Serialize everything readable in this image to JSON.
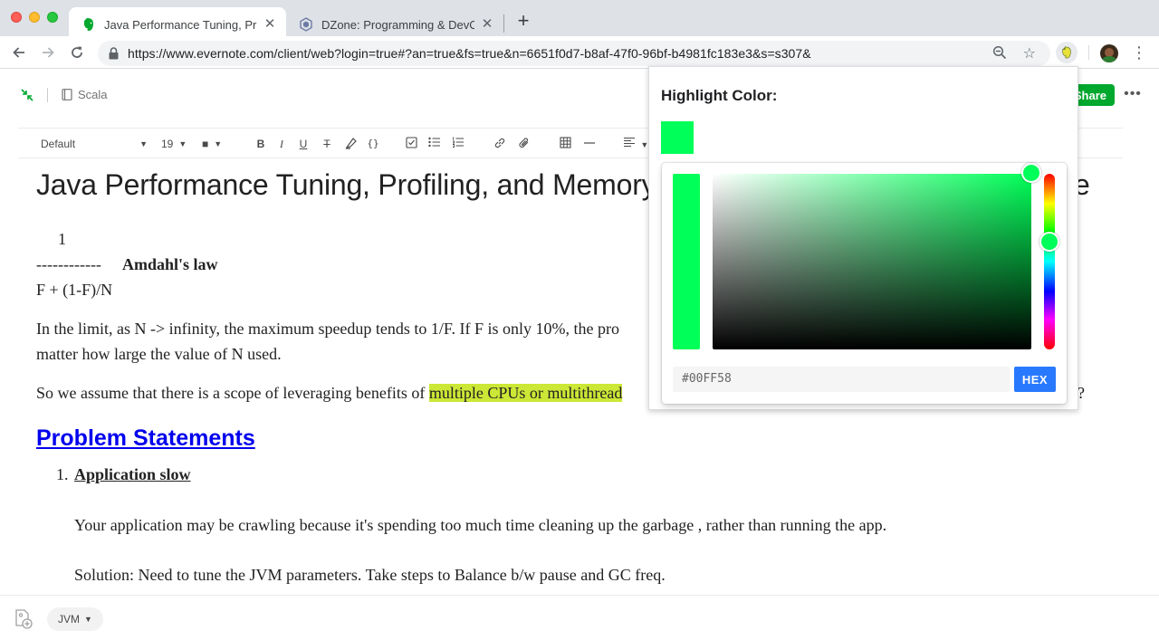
{
  "browser": {
    "tabs": [
      {
        "title": "Java Performance Tuning, Profiling, and Memory Management",
        "active": true,
        "favicon": "evernote-icon"
      },
      {
        "title": "DZone: Programming & DevOps",
        "active": false,
        "favicon": "dzone-icon"
      }
    ],
    "tab_close_glyph": "✕",
    "new_tab_glyph": "+",
    "url": "https://www.evernote.com/client/web?login=true#?an=true&fs=true&n=6651f0d7-b8af-47f0-96bf-b4981fc183e3&s=s307&"
  },
  "note_header": {
    "notebook": "Scala",
    "share_label": "Share",
    "more_glyph": "•••"
  },
  "format_toolbar": {
    "style": "Default",
    "font_size": "19",
    "color_glyph": "■"
  },
  "note": {
    "title": "Java Performance Tuning, Profiling, and Memory",
    "title_end": "e",
    "line_1": "1",
    "dashes": "------------",
    "amdahl": "Amdahl's law",
    "formula": "F + (1-F)/N",
    "para1_a": "In the limit, as N -> infinity, the maximum speedup tends to 1/F. If F is only 10%, the pro",
    "para1_b": "matter how large the value of N used.",
    "para2_a": "So we assume that there is a scope of leveraging benefits of ",
    "para2_hl": "multiple CPUs or multithread",
    "para2_end": "?",
    "section_heading": "Problem Statements",
    "list_number": "1.",
    "list_title": "Application slow",
    "para3": "Your application may be crawling because it's spending too much time cleaning up the garbage , rather than running the app.",
    "para4": "Solution: Need to tune the JVM parameters. Take steps to Balance b/w pause and GC freq."
  },
  "footer": {
    "tag": "JVM"
  },
  "highlight_popup": {
    "title": "Highlight Color:",
    "hex_value": "#00FF58",
    "hex_button": "HEX",
    "selected_color": "#00ff58"
  },
  "colors": {
    "evernote_green": "#00a82d",
    "highlight_yellow": "#cde736",
    "link_blue": "#0000ee",
    "hex_button_blue": "#2979ff"
  }
}
